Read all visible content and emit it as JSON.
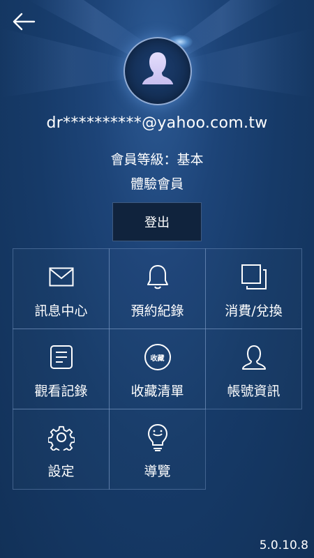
{
  "profile": {
    "email": "dr**********@yahoo.com.tw",
    "member_level": "會員等級：基本",
    "member_type": "體驗會員"
  },
  "logout_label": "登出",
  "menu": [
    {
      "label": "訊息中心",
      "icon": "envelope-icon"
    },
    {
      "label": "預約紀錄",
      "icon": "bell-icon"
    },
    {
      "label": "消費/兌換",
      "icon": "copy-squares-icon"
    },
    {
      "label": "觀看記錄",
      "icon": "document-icon"
    },
    {
      "label": "收藏清單",
      "icon": "favorite-badge-icon",
      "icon_text": "收藏"
    },
    {
      "label": "帳號資訊",
      "icon": "user-icon"
    },
    {
      "label": "設定",
      "icon": "gear-icon"
    },
    {
      "label": "導覽",
      "icon": "lightbulb-icon"
    }
  ],
  "version": "5.0.10.8",
  "colors": {
    "background": "#1d4478",
    "button_bg": "#10233d",
    "grid_border": "#5a7aa8",
    "text": "#ffffff"
  }
}
